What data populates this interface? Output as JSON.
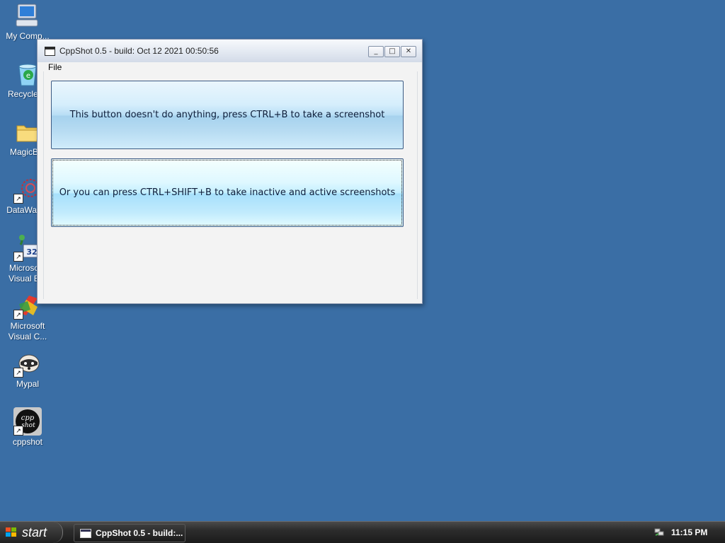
{
  "desktop": {
    "icons": [
      {
        "label": "My Comp...",
        "icon": "my-computer-icon"
      },
      {
        "label": "Recycle ...",
        "icon": "recycle-bin-icon"
      },
      {
        "label": "MagicB...",
        "icon": "folder-icon"
      },
      {
        "label": "DataWag...",
        "icon": "datawag-icon"
      },
      {
        "label": "Microso...\nVisual B...",
        "icon": "visual-basic-icon"
      },
      {
        "label": "Microsoft\nVisual C...",
        "icon": "visual-cpp-icon"
      },
      {
        "label": "Mypal",
        "icon": "mypal-icon"
      },
      {
        "label": "cppshot",
        "icon": "cppshot-icon"
      }
    ]
  },
  "window": {
    "title": "CppShot 0.5 - build: Oct 12 2021 00:50:56",
    "controls": {
      "minimize": "_",
      "maximize": "□",
      "close": "✕"
    },
    "menu": [
      "File"
    ],
    "button1_label": "This button doesn't do anything, press CTRL+B to take a screenshot",
    "button2_label": "Or you can press CTRL+SHIFT+B to take inactive and active screenshots"
  },
  "taskbar": {
    "start_label": "start",
    "task_button_label": "CppShot 0.5 - build:...",
    "clock": "11:15 PM"
  },
  "colors": {
    "desktop_bg": "#3a6ea5",
    "taskbar_bg": "#1b1b1b"
  }
}
